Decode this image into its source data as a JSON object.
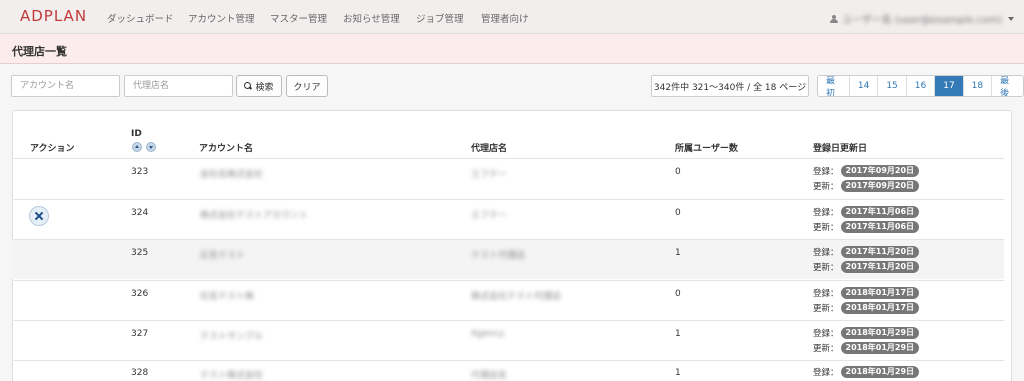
{
  "navbar": {
    "brand": "ADPLAN",
    "items": [
      "ダッシュボード",
      "アカウント管理",
      "マスター管理",
      "お知らせ管理",
      "ジョブ管理",
      "管理者向け"
    ],
    "user": "ユーザー名 (user@example.com)"
  },
  "page": {
    "title": "代理店一覧"
  },
  "filters": {
    "account_placeholder": "アカウント名",
    "agency_placeholder": "代理店名",
    "search_label": "検索",
    "clear_label": "クリア"
  },
  "count": "342件中 321～340件 / 全 18 ページ",
  "pagination": {
    "first": "最初",
    "pages": [
      "14",
      "15",
      "16",
      "17",
      "18"
    ],
    "active": "17",
    "last": "最後"
  },
  "table": {
    "headers": {
      "action": "アクション",
      "id": "ID",
      "account": "アカウント名",
      "agency": "代理店名",
      "users": "所属ユーザー数",
      "dates": "登録日更新日"
    },
    "reg_label": "登録：",
    "upd_label": "更新：",
    "rows": [
      {
        "id": "323",
        "account": "会社名株式会社",
        "agency": "エフテー",
        "users": "0",
        "registered": "2017年09月20日",
        "updated": "2017年09月20日",
        "deletable": false
      },
      {
        "id": "324",
        "account": "株式会社テストアカウント",
        "agency": "エフテー",
        "users": "0",
        "registered": "2017年11月06日",
        "updated": "2017年11月06日",
        "deletable": true
      },
      {
        "id": "325",
        "account": "広告テスト",
        "agency": "テスト代理店",
        "users": "1",
        "registered": "2017年11月20日",
        "updated": "2017年11月20日",
        "deletable": false
      },
      {
        "id": "326",
        "account": "社名テスト株",
        "agency": "株式会社テスト代理店",
        "users": "0",
        "registered": "2018年01月17日",
        "updated": "2018年01月17日",
        "deletable": false
      },
      {
        "id": "327",
        "account": "テストサンプル",
        "agency": "Agency",
        "users": "1",
        "registered": "2018年01月29日",
        "updated": "2018年01月29日",
        "deletable": false
      },
      {
        "id": "328",
        "account": "テスト株式会社",
        "agency": "代理店名",
        "users": "1",
        "registered": "2018年01月29日",
        "updated": "",
        "deletable": false
      }
    ]
  }
}
